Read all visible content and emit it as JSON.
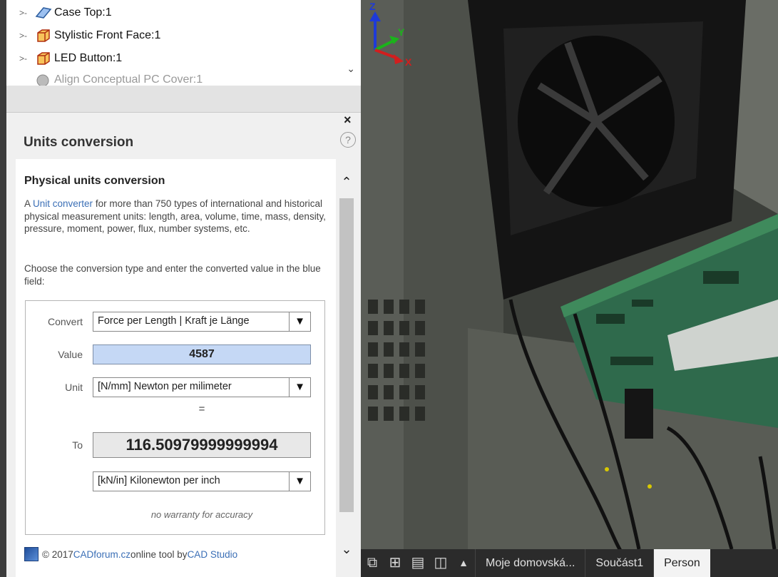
{
  "browser_tree": {
    "items": [
      {
        "label": "Case Top:1",
        "icon": "sketch-plane-icon"
      },
      {
        "label": "Stylistic Front Face:1",
        "icon": "part-cube-icon"
      },
      {
        "label": "LED Button:1",
        "icon": "part-cube-icon"
      },
      {
        "label": "Align Conceptual PC Cover:1",
        "icon": "constraint-icon"
      }
    ]
  },
  "palette": {
    "title": "Units conversion",
    "close_glyph": "×",
    "help_glyph": "?"
  },
  "content": {
    "heading": "Physical units conversion",
    "para1_prefix": "A ",
    "para1_link": "Unit converter",
    "para1_suffix": " for more than 750 types of international and historical physical measurement units: length, area, volume, time, mass, density, pressure, moment, power, flux, number systems, etc.",
    "para2": "Choose the conversion type and enter the converted value in the blue field:"
  },
  "form": {
    "convert_label": "Convert",
    "convert_value": "Force per Length | Kraft je Länge",
    "value_label": "Value",
    "value": "4587",
    "unit_label": "Unit",
    "unit_value": "[N/mm] Newton per milimeter",
    "equals": "=",
    "to_label": "To",
    "result": "116.50979999999994",
    "to_unit_value": "[kN/in] Kilonewton per inch",
    "warranty": "no warranty for accuracy"
  },
  "footer": {
    "copyright": "© 2017 ",
    "link1": "CADforum.cz",
    "middle": " online tool by ",
    "link2": "CAD Studio"
  },
  "statusbar": {
    "tabs": [
      {
        "label": "Moje domovská...",
        "active": false
      },
      {
        "label": "Součást1",
        "active": false
      },
      {
        "label": "Person",
        "active": true
      }
    ]
  },
  "axes": {
    "x": "X",
    "y": "Y",
    "z": "Z"
  },
  "colors": {
    "value_field": "#c5d8f5",
    "link": "#3b6fb6",
    "statusbar": "#2b2b2b"
  }
}
